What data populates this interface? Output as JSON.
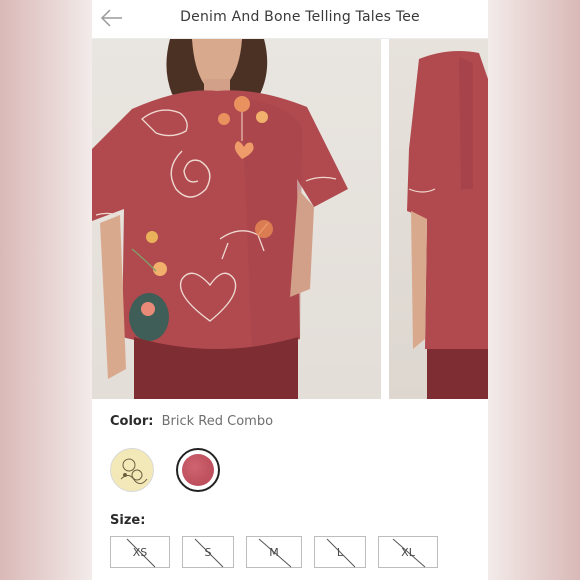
{
  "header": {
    "back_icon": "arrow-left-icon",
    "title": "Denim And Bone Telling Tales Tee"
  },
  "gallery": {
    "images": [
      "front-view-photo",
      "side-view-photo"
    ]
  },
  "color": {
    "label": "Color:",
    "selected": "Brick Red Combo",
    "swatches": [
      {
        "name": "cream-swatch",
        "hex": "#f3e9b8",
        "selected": false
      },
      {
        "name": "brick-red-swatch",
        "hex": "#c65766",
        "selected": true
      }
    ]
  },
  "size": {
    "label": "Size:",
    "options": [
      {
        "label": "XS",
        "available": false
      },
      {
        "label": "S",
        "available": false
      },
      {
        "label": "M",
        "available": false
      },
      {
        "label": "L",
        "available": false
      },
      {
        "label": "XL",
        "available": false
      }
    ]
  },
  "colors": {
    "tee": "#b04a4f",
    "background": "#f3eceb"
  }
}
